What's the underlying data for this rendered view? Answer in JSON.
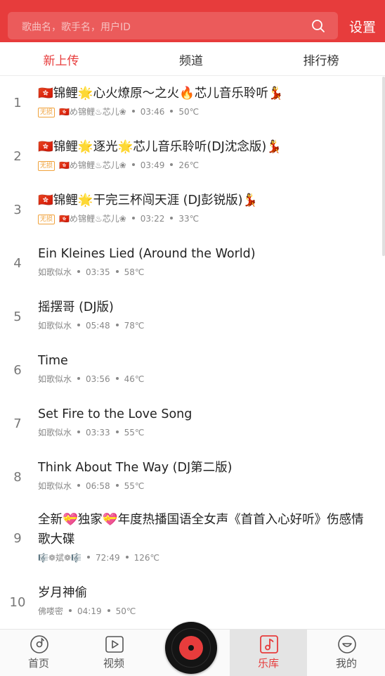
{
  "header": {
    "search_placeholder": "歌曲名，歌手名，用户ID",
    "settings_label": "设置"
  },
  "tabs": [
    {
      "label": "新上传",
      "active": true
    },
    {
      "label": "频道",
      "active": false
    },
    {
      "label": "排行榜",
      "active": false
    }
  ],
  "songs": [
    {
      "index": "1",
      "title": "🇭🇰锦鲤🌟心火燎原～之火🔥芯儿音乐聆听💃",
      "badge": "无损",
      "uploader": "🇭🇰め锦鲤♨芯儿❀",
      "duration": "03:46",
      "heat": "50℃"
    },
    {
      "index": "2",
      "title": "🇭🇰锦鲤🌟逐光🌟芯儿音乐聆听(DJ沈念版)💃",
      "badge": "无损",
      "uploader": "🇭🇰め锦鲤♨芯儿❀",
      "duration": "03:49",
      "heat": "26℃"
    },
    {
      "index": "3",
      "title": "🇭🇰锦鲤🌟干完三杯闯天涯 (DJ彭锐版)💃",
      "badge": "无损",
      "uploader": "🇭🇰め锦鲤♨芯儿❀",
      "duration": "03:22",
      "heat": "33℃"
    },
    {
      "index": "4",
      "title": "Ein Kleines Lied (Around the World)",
      "badge": "",
      "uploader": "如歌似水",
      "duration": "03:35",
      "heat": "58℃"
    },
    {
      "index": "5",
      "title": "摇摆哥 (DJ版)",
      "badge": "",
      "uploader": "如歌似水",
      "duration": "05:48",
      "heat": "78℃"
    },
    {
      "index": "6",
      "title": "Time",
      "badge": "",
      "uploader": "如歌似水",
      "duration": "03:56",
      "heat": "46℃"
    },
    {
      "index": "7",
      "title": "Set Fire to the Love Song",
      "badge": "",
      "uploader": "如歌似水",
      "duration": "03:33",
      "heat": "55℃"
    },
    {
      "index": "8",
      "title": "Think About The Way (DJ第二版)",
      "badge": "",
      "uploader": "如歌似水",
      "duration": "06:58",
      "heat": "55℃"
    },
    {
      "index": "9",
      "title": "全新💝独家💝年度热播国语全女声《首首入心好听》伤感情歌大碟",
      "badge": "",
      "uploader": "🎼❁斌❁🎼",
      "duration": "72:49",
      "heat": "126℃"
    },
    {
      "index": "10",
      "title": "岁月神偷",
      "badge": "",
      "uploader": "佛喽密",
      "duration": "04:19",
      "heat": "50℃"
    }
  ],
  "bottom_nav": [
    {
      "label": "首页",
      "icon": "disc-icon",
      "active": false
    },
    {
      "label": "视频",
      "icon": "video-icon",
      "active": false
    },
    {
      "label": "乐库",
      "icon": "music-note-icon",
      "active": true
    },
    {
      "label": "我的",
      "icon": "smile-icon",
      "active": false
    }
  ],
  "player": {
    "icon": "vinyl-record-icon"
  },
  "colors": {
    "accent": "#e73c3c",
    "badge": "#f0a23b"
  }
}
